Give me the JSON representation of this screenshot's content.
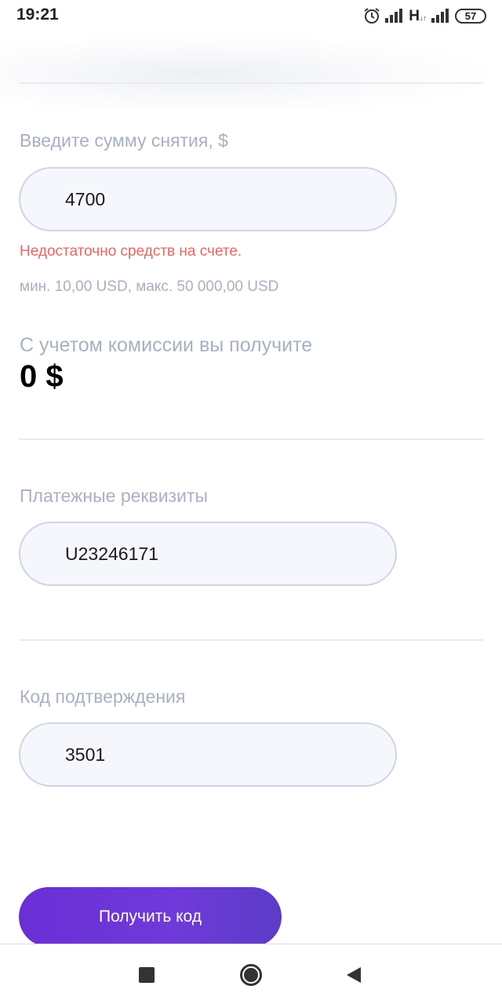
{
  "status_bar": {
    "time": "19:21",
    "network": "H",
    "network_sub": "↓↑",
    "battery": "57"
  },
  "withdraw": {
    "amount_label": "Введите сумму снятия, $",
    "amount_value": "4700",
    "error": "Недостаточно средств на счете.",
    "limits": "мин. 10,00 USD, макс. 50 000,00 USD",
    "receive_label": "С учетом комиссии вы получите",
    "receive_amount": "0 $"
  },
  "payment": {
    "label": "Платежные реквизиты",
    "value": "U23246171"
  },
  "confirmation": {
    "label": "Код подтверждения",
    "value": "3501",
    "button": "Получить код"
  },
  "colors": {
    "accent": "#6a2fd6",
    "error": "#ef6461",
    "label": "#a7b1c2"
  }
}
